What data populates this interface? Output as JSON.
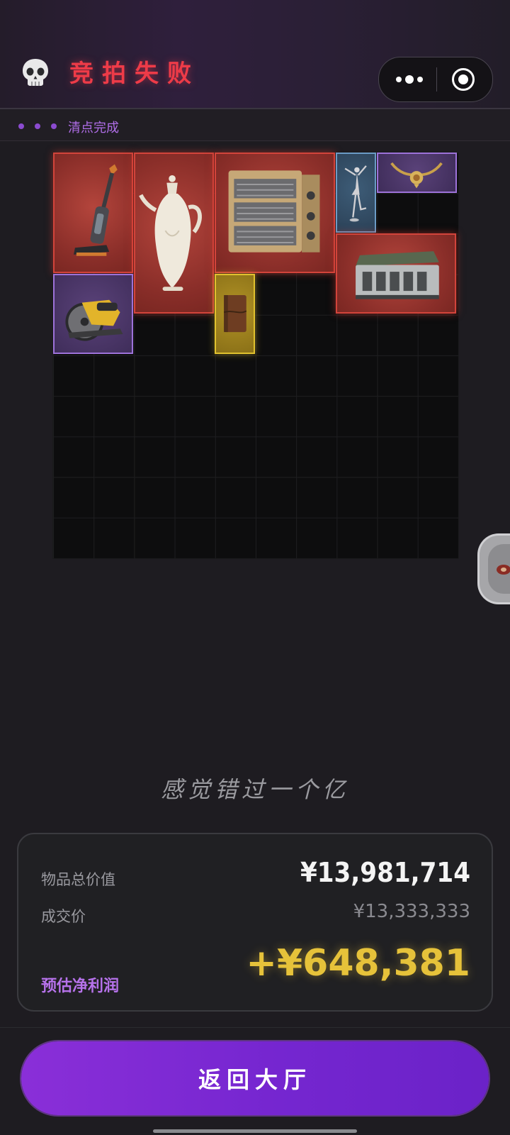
{
  "header": {
    "title": "竞拍失败",
    "skull_icon": "skull-icon",
    "menu_icon": "more-dots-icon",
    "target_icon": "target-icon"
  },
  "status": {
    "text": "清点完成"
  },
  "grid": {
    "rows": 10,
    "cols": 10,
    "items": [
      {
        "name": "vacuum-cleaner",
        "rarity": "red"
      },
      {
        "name": "white-porcelain-ewer",
        "rarity": "red"
      },
      {
        "name": "military-ammo-crate",
        "rarity": "red"
      },
      {
        "name": "ballerina-figurine",
        "rarity": "blue"
      },
      {
        "name": "bull-horn-pendant",
        "rarity": "purple"
      },
      {
        "name": "circular-saw",
        "rarity": "purple"
      },
      {
        "name": "leather-journal",
        "rarity": "gold"
      },
      {
        "name": "green-metal-toolbox",
        "rarity": "red"
      }
    ]
  },
  "slogan": "感觉错过一个亿",
  "summary": {
    "total_label": "物品总价值",
    "total_value": "¥13,981,714",
    "deal_label": "成交价",
    "deal_value": "¥13,333,333",
    "profit_label": "预估净利润",
    "profit_value": "+¥648,381"
  },
  "actions": {
    "return_label": "返回大厅"
  },
  "colors": {
    "red_rarity": "#d2443b",
    "purple_rarity": "#9d72d9",
    "blue_rarity": "#6b9bc6",
    "gold_rarity": "#e0c12e",
    "accent": "#8a2fd8",
    "profit": "#e6c23a"
  }
}
